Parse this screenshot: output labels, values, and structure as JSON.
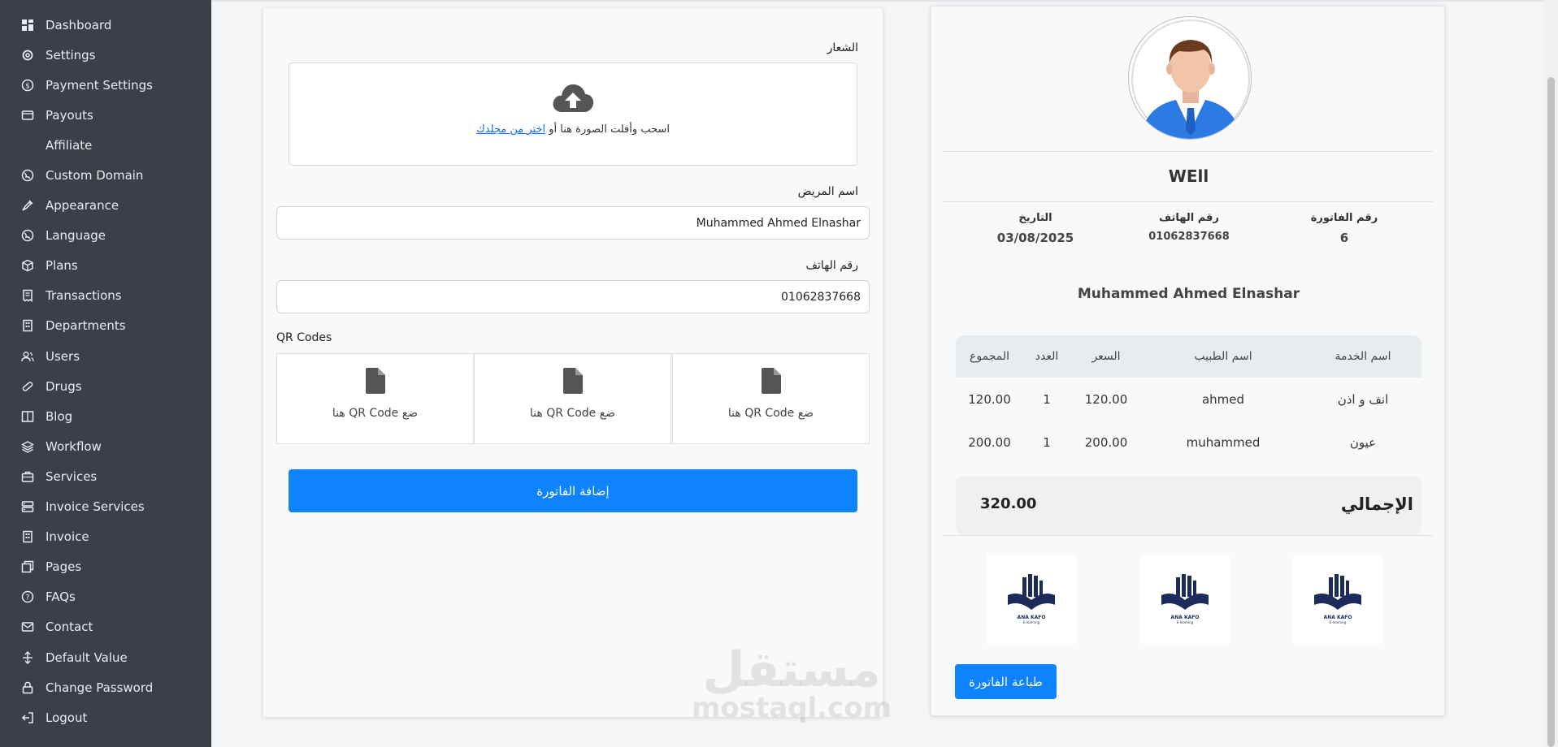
{
  "sidebar": {
    "items": [
      {
        "label": "Dashboard",
        "icon": "dashboard-icon"
      },
      {
        "label": "Settings",
        "icon": "gear-icon"
      },
      {
        "label": "Payment Settings",
        "icon": "dollar-icon"
      },
      {
        "label": "Payouts",
        "icon": "wallet-icon"
      },
      {
        "label": "Affiliate",
        "icon": ""
      },
      {
        "label": "Custom Domain",
        "icon": "globe-icon"
      },
      {
        "label": "Appearance",
        "icon": "brush-icon"
      },
      {
        "label": "Language",
        "icon": "globe-icon"
      },
      {
        "label": "Plans",
        "icon": "box-icon"
      },
      {
        "label": "Transactions",
        "icon": "receipt-icon"
      },
      {
        "label": "Departments",
        "icon": "building-icon"
      },
      {
        "label": "Users",
        "icon": "users-icon"
      },
      {
        "label": "Drugs",
        "icon": "pill-icon"
      },
      {
        "label": "Blog",
        "icon": "book-icon"
      },
      {
        "label": "Workflow",
        "icon": "layers-icon"
      },
      {
        "label": "Services",
        "icon": "briefcase-icon"
      },
      {
        "label": "Invoice Services",
        "icon": "server-icon"
      },
      {
        "label": "Invoice",
        "icon": "building-icon"
      },
      {
        "label": "Pages",
        "icon": "pages-icon"
      },
      {
        "label": "FAQs",
        "icon": "question-icon"
      },
      {
        "label": "Contact",
        "icon": "mail-icon"
      },
      {
        "label": "Default Value",
        "icon": "split-icon"
      },
      {
        "label": "Change Password",
        "icon": "lock-icon"
      },
      {
        "label": "Logout",
        "icon": "logout-icon"
      }
    ]
  },
  "form": {
    "logo_label": "الشعار",
    "dropzone_text": "اسحب وأفلت الصورة هنا أو",
    "dropzone_link": "اختر من مجلدك",
    "patient_label": "اسم المريض",
    "patient_value": "Muhammed Ahmed Elnashar",
    "phone_label": "رقم الهاتف",
    "phone_value": "01062837668",
    "qr_label": "QR Codes",
    "qr_boxes": [
      {
        "text": "ضع QR Code هنا"
      },
      {
        "text": "ضع QR Code هنا"
      },
      {
        "text": "ضع QR Code هنا"
      }
    ],
    "submit_label": "إضافة الفاتورة"
  },
  "watermark": {
    "arabic": "مستقل",
    "latin": "mostaql.com"
  },
  "invoice": {
    "clinic_name": "WEll",
    "invoice_no_label": "رقم الفاتورة",
    "invoice_no": "6",
    "phone_label": "رقم الهاتف",
    "phone": "01062837668",
    "date_label": "التاريخ",
    "date": "03/08/2025",
    "patient": "Muhammed Ahmed Elnashar",
    "table": {
      "headers": [
        "اسم الخدمة",
        "اسم الطبيب",
        "السعر",
        "العدد",
        "المجموع"
      ],
      "rows": [
        [
          "انف و اذن",
          "ahmed",
          "120.00",
          "1",
          "120.00"
        ],
        [
          "عيون",
          "muhammed",
          "200.00",
          "1",
          "200.00"
        ]
      ]
    },
    "total_label": "الإجمالي",
    "total_value": "320.00",
    "logos": [
      {
        "brand": "ANA KAFO",
        "tagline": "E-learning"
      },
      {
        "brand": "ANA KAFO",
        "tagline": "E-learning"
      },
      {
        "brand": "ANA KAFO",
        "tagline": "E-learning"
      }
    ],
    "print_label": "طباعة الفاتورة"
  },
  "colors": {
    "primary": "#0d83ff",
    "sidebar": "#3a3f48",
    "logo_navy": "#1b2b5c"
  }
}
